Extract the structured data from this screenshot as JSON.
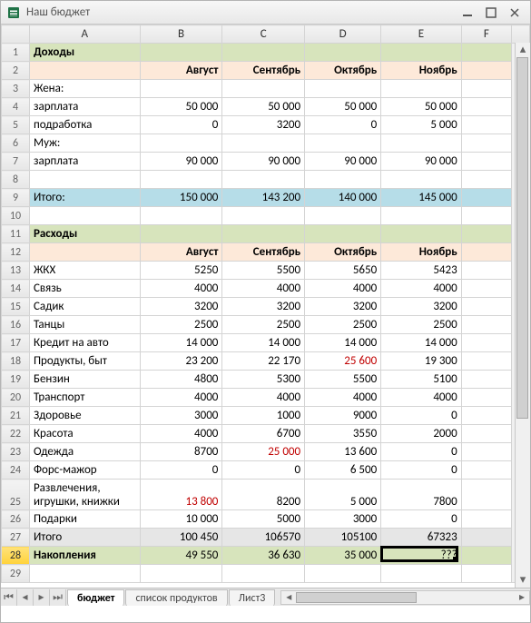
{
  "window": {
    "title": "Наш бюджет"
  },
  "columns": [
    "A",
    "B",
    "C",
    "D",
    "E",
    "F"
  ],
  "active_column": "E",
  "active_row": 28,
  "months": [
    "Август",
    "Сентябрь",
    "Октябрь",
    "Ноябрь"
  ],
  "income": {
    "heading": "Доходы",
    "wife_label": "Жена:",
    "husband_label": "Муж:",
    "salary_label": "зарплата",
    "side_label": "подработка",
    "wife_salary": [
      "50 000",
      "50 000",
      "50 000",
      "50 000"
    ],
    "wife_side": [
      "0",
      "3200",
      "0",
      "5 000"
    ],
    "husband_salary": [
      "90 000",
      "90 000",
      "90 000",
      "90 000"
    ],
    "total_label": "Итого:",
    "total": [
      "150 000",
      "143 200",
      "140 000",
      "145 000"
    ]
  },
  "expenses": {
    "heading": "Расходы",
    "rows": [
      {
        "label": "ЖКХ",
        "v": [
          "5250",
          "5500",
          "5650",
          "5423"
        ]
      },
      {
        "label": "Связь",
        "v": [
          "4000",
          "4000",
          "4000",
          "4000"
        ]
      },
      {
        "label": "Садик",
        "v": [
          "3200",
          "3200",
          "3200",
          "3200"
        ]
      },
      {
        "label": "Танцы",
        "v": [
          "2500",
          "2500",
          "2500",
          "2500"
        ]
      },
      {
        "label": "Кредит на авто",
        "v": [
          "14 000",
          "14 000",
          "14 000",
          "14 000"
        ]
      },
      {
        "label": "Продукты, быт",
        "v": [
          "23 200",
          "22 170",
          "25 600",
          "19 300"
        ],
        "red": [
          2
        ]
      },
      {
        "label": "Бензин",
        "v": [
          "4800",
          "5300",
          "5500",
          "5100"
        ]
      },
      {
        "label": "Транспорт",
        "v": [
          "4000",
          "4000",
          "4000",
          "4000"
        ]
      },
      {
        "label": "Здоровье",
        "v": [
          "3000",
          "1000",
          "9000",
          "0"
        ]
      },
      {
        "label": "Красота",
        "v": [
          "4000",
          "6700",
          "3550",
          "2000"
        ]
      },
      {
        "label": "Одежда",
        "v": [
          "8700",
          "25 000",
          "13 600",
          "0"
        ],
        "red": [
          1
        ]
      },
      {
        "label": "Форс-мажор",
        "v": [
          "0",
          "0",
          "6 500",
          "0"
        ]
      },
      {
        "label": "Развлечения, игрушки, книжки",
        "v": [
          "13 800",
          "8200",
          "5 000",
          "7800"
        ],
        "red": [
          0
        ],
        "tall": true
      },
      {
        "label": "Подарки",
        "v": [
          "10 000",
          "5000",
          "3000",
          "0"
        ]
      }
    ],
    "total_label": "Итого",
    "total": [
      "100 450",
      "106570",
      "105100",
      "67323"
    ],
    "savings_label": "Накопления",
    "savings": [
      "49 550",
      "36 630",
      "35 000",
      "???"
    ]
  },
  "tabs": {
    "items": [
      "бюджет",
      "список продуктов",
      "Лист3"
    ],
    "active": 0
  }
}
